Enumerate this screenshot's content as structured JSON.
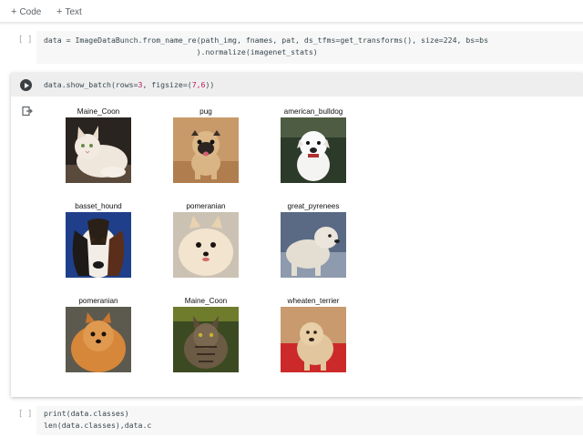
{
  "toolbar": {
    "add_code": "Code",
    "add_text": "Text"
  },
  "cell1": {
    "bracket": "[ ]",
    "line1": "data = ImageDataBunch.from_name_re(path_img, fnames, pat, ds_tfms=get_transforms(), size=224, bs=bs",
    "line2": "                                  ).normalize(imagenet_stats)"
  },
  "cell2": {
    "code_prefix": "data.show_batch(rows=",
    "rows_value": "3",
    "code_mid": ", figsize=(",
    "figsize_value": "7,6",
    "code_suffix": "))",
    "grid": [
      {
        "label": "Maine_Coon",
        "image": "white-cat-photo"
      },
      {
        "label": "pug",
        "image": "pug-photo"
      },
      {
        "label": "american_bulldog",
        "image": "white-bulldog-photo"
      },
      {
        "label": "basset_hound",
        "image": "basset-hound-photo"
      },
      {
        "label": "pomeranian",
        "image": "white-pomeranian-photo"
      },
      {
        "label": "great_pyrenees",
        "image": "great-pyrenees-photo"
      },
      {
        "label": "pomeranian",
        "image": "orange-pomeranian-photo"
      },
      {
        "label": "Maine_Coon",
        "image": "tabby-cat-photo"
      },
      {
        "label": "wheaten_terrier",
        "image": "wheaten-terrier-photo"
      }
    ]
  },
  "cell3": {
    "bracket": "[ ]",
    "line1": "print(data.classes)",
    "line2": "len(data.classes),data.c"
  },
  "colors": {
    "toolbar_text": "#5f6368",
    "code_bg": "#f7f7f7",
    "active_code_bg": "#eeeeee",
    "number": "#c2185b"
  }
}
